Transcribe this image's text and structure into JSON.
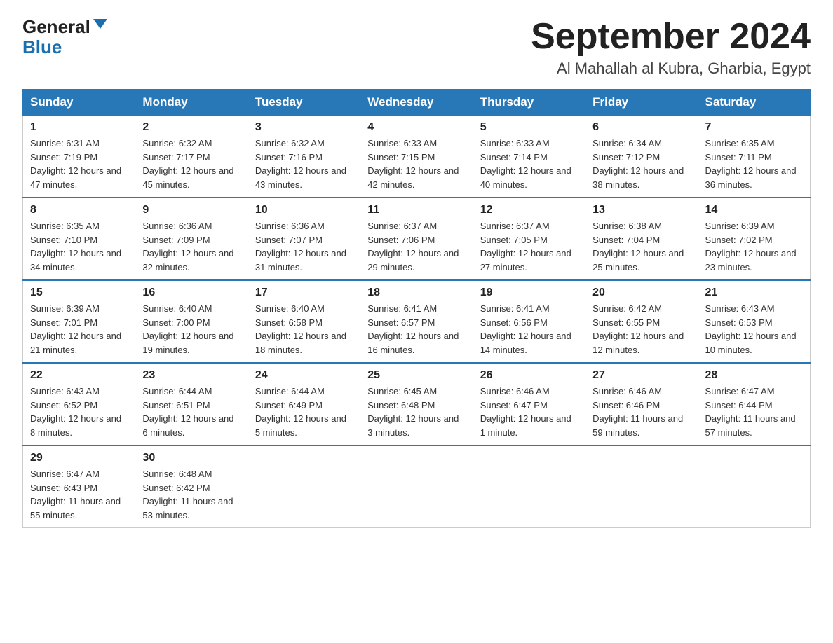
{
  "header": {
    "logo_general": "General",
    "logo_blue": "Blue",
    "title": "September 2024",
    "subtitle": "Al Mahallah al Kubra, Gharbia, Egypt"
  },
  "weekdays": [
    "Sunday",
    "Monday",
    "Tuesday",
    "Wednesday",
    "Thursday",
    "Friday",
    "Saturday"
  ],
  "weeks": [
    [
      {
        "day": "1",
        "sunrise": "Sunrise: 6:31 AM",
        "sunset": "Sunset: 7:19 PM",
        "daylight": "Daylight: 12 hours and 47 minutes."
      },
      {
        "day": "2",
        "sunrise": "Sunrise: 6:32 AM",
        "sunset": "Sunset: 7:17 PM",
        "daylight": "Daylight: 12 hours and 45 minutes."
      },
      {
        "day": "3",
        "sunrise": "Sunrise: 6:32 AM",
        "sunset": "Sunset: 7:16 PM",
        "daylight": "Daylight: 12 hours and 43 minutes."
      },
      {
        "day": "4",
        "sunrise": "Sunrise: 6:33 AM",
        "sunset": "Sunset: 7:15 PM",
        "daylight": "Daylight: 12 hours and 42 minutes."
      },
      {
        "day": "5",
        "sunrise": "Sunrise: 6:33 AM",
        "sunset": "Sunset: 7:14 PM",
        "daylight": "Daylight: 12 hours and 40 minutes."
      },
      {
        "day": "6",
        "sunrise": "Sunrise: 6:34 AM",
        "sunset": "Sunset: 7:12 PM",
        "daylight": "Daylight: 12 hours and 38 minutes."
      },
      {
        "day": "7",
        "sunrise": "Sunrise: 6:35 AM",
        "sunset": "Sunset: 7:11 PM",
        "daylight": "Daylight: 12 hours and 36 minutes."
      }
    ],
    [
      {
        "day": "8",
        "sunrise": "Sunrise: 6:35 AM",
        "sunset": "Sunset: 7:10 PM",
        "daylight": "Daylight: 12 hours and 34 minutes."
      },
      {
        "day": "9",
        "sunrise": "Sunrise: 6:36 AM",
        "sunset": "Sunset: 7:09 PM",
        "daylight": "Daylight: 12 hours and 32 minutes."
      },
      {
        "day": "10",
        "sunrise": "Sunrise: 6:36 AM",
        "sunset": "Sunset: 7:07 PM",
        "daylight": "Daylight: 12 hours and 31 minutes."
      },
      {
        "day": "11",
        "sunrise": "Sunrise: 6:37 AM",
        "sunset": "Sunset: 7:06 PM",
        "daylight": "Daylight: 12 hours and 29 minutes."
      },
      {
        "day": "12",
        "sunrise": "Sunrise: 6:37 AM",
        "sunset": "Sunset: 7:05 PM",
        "daylight": "Daylight: 12 hours and 27 minutes."
      },
      {
        "day": "13",
        "sunrise": "Sunrise: 6:38 AM",
        "sunset": "Sunset: 7:04 PM",
        "daylight": "Daylight: 12 hours and 25 minutes."
      },
      {
        "day": "14",
        "sunrise": "Sunrise: 6:39 AM",
        "sunset": "Sunset: 7:02 PM",
        "daylight": "Daylight: 12 hours and 23 minutes."
      }
    ],
    [
      {
        "day": "15",
        "sunrise": "Sunrise: 6:39 AM",
        "sunset": "Sunset: 7:01 PM",
        "daylight": "Daylight: 12 hours and 21 minutes."
      },
      {
        "day": "16",
        "sunrise": "Sunrise: 6:40 AM",
        "sunset": "Sunset: 7:00 PM",
        "daylight": "Daylight: 12 hours and 19 minutes."
      },
      {
        "day": "17",
        "sunrise": "Sunrise: 6:40 AM",
        "sunset": "Sunset: 6:58 PM",
        "daylight": "Daylight: 12 hours and 18 minutes."
      },
      {
        "day": "18",
        "sunrise": "Sunrise: 6:41 AM",
        "sunset": "Sunset: 6:57 PM",
        "daylight": "Daylight: 12 hours and 16 minutes."
      },
      {
        "day": "19",
        "sunrise": "Sunrise: 6:41 AM",
        "sunset": "Sunset: 6:56 PM",
        "daylight": "Daylight: 12 hours and 14 minutes."
      },
      {
        "day": "20",
        "sunrise": "Sunrise: 6:42 AM",
        "sunset": "Sunset: 6:55 PM",
        "daylight": "Daylight: 12 hours and 12 minutes."
      },
      {
        "day": "21",
        "sunrise": "Sunrise: 6:43 AM",
        "sunset": "Sunset: 6:53 PM",
        "daylight": "Daylight: 12 hours and 10 minutes."
      }
    ],
    [
      {
        "day": "22",
        "sunrise": "Sunrise: 6:43 AM",
        "sunset": "Sunset: 6:52 PM",
        "daylight": "Daylight: 12 hours and 8 minutes."
      },
      {
        "day": "23",
        "sunrise": "Sunrise: 6:44 AM",
        "sunset": "Sunset: 6:51 PM",
        "daylight": "Daylight: 12 hours and 6 minutes."
      },
      {
        "day": "24",
        "sunrise": "Sunrise: 6:44 AM",
        "sunset": "Sunset: 6:49 PM",
        "daylight": "Daylight: 12 hours and 5 minutes."
      },
      {
        "day": "25",
        "sunrise": "Sunrise: 6:45 AM",
        "sunset": "Sunset: 6:48 PM",
        "daylight": "Daylight: 12 hours and 3 minutes."
      },
      {
        "day": "26",
        "sunrise": "Sunrise: 6:46 AM",
        "sunset": "Sunset: 6:47 PM",
        "daylight": "Daylight: 12 hours and 1 minute."
      },
      {
        "day": "27",
        "sunrise": "Sunrise: 6:46 AM",
        "sunset": "Sunset: 6:46 PM",
        "daylight": "Daylight: 11 hours and 59 minutes."
      },
      {
        "day": "28",
        "sunrise": "Sunrise: 6:47 AM",
        "sunset": "Sunset: 6:44 PM",
        "daylight": "Daylight: 11 hours and 57 minutes."
      }
    ],
    [
      {
        "day": "29",
        "sunrise": "Sunrise: 6:47 AM",
        "sunset": "Sunset: 6:43 PM",
        "daylight": "Daylight: 11 hours and 55 minutes."
      },
      {
        "day": "30",
        "sunrise": "Sunrise: 6:48 AM",
        "sunset": "Sunset: 6:42 PM",
        "daylight": "Daylight: 11 hours and 53 minutes."
      },
      null,
      null,
      null,
      null,
      null
    ]
  ]
}
